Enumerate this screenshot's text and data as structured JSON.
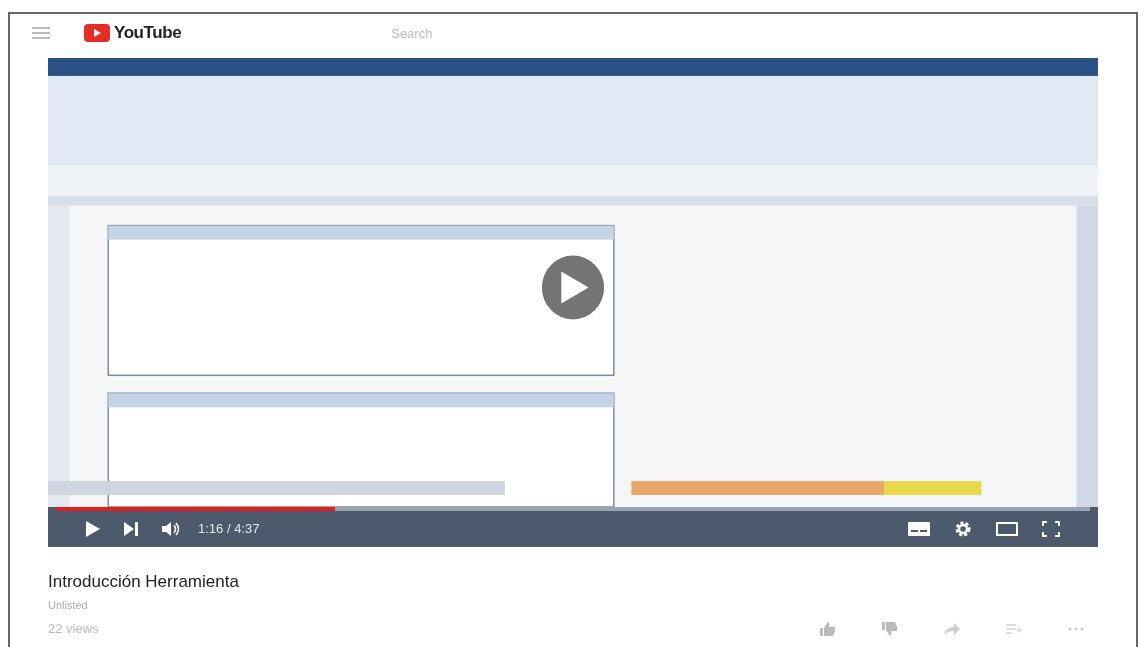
{
  "header": {
    "logo": "YouTube",
    "search": {
      "placeholder": "Search"
    }
  },
  "player": {
    "progress": {
      "level": 0.27
    },
    "time": "1:16 / 4:37"
  },
  "video": {
    "title": "Introducción Herramienta",
    "privacy": "Unlisted",
    "views": "22 views"
  }
}
